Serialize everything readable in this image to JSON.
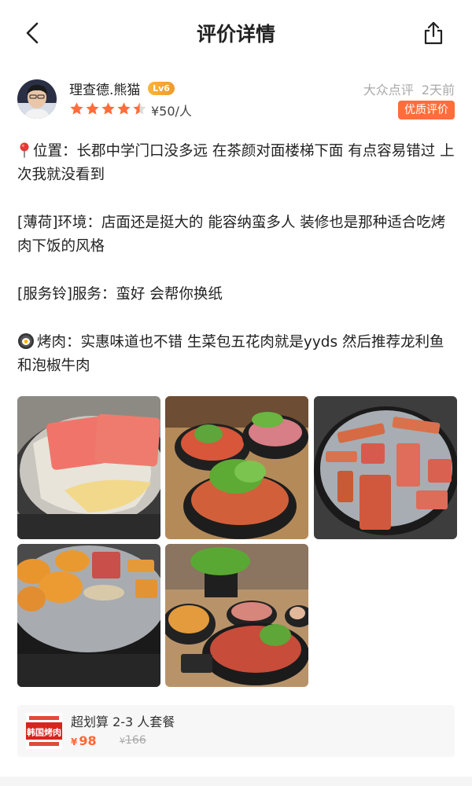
{
  "nav": {
    "title": "评价详情"
  },
  "user": {
    "name": "理查德.熊猫",
    "level": "Lv6",
    "rating": 4.5,
    "price": "¥50/人"
  },
  "meta": {
    "source": "大众点评",
    "time": "2天前",
    "badge": "优质评价"
  },
  "review": {
    "para1": "位置：长郡中学门口没多远 在茶颜对面楼梯下面 有点容易错过 上次我就没看到",
    "para2": "[薄荷]环境：店面还是挺大的 能容纳蛮多人 装修也是那种适合吃烤肉下饭的风格",
    "para3": "[服务铃]服务：蛮好 会帮你换纸",
    "para4": "烤肉：实惠味道也不错 生菜包五花肉就是yyds 然后推荐龙利鱼和泡椒牛肉"
  },
  "photos_count": 5,
  "deal": {
    "title": "超划算 2-3 人套餐",
    "currency": "¥",
    "price": "98",
    "original_currency": "¥",
    "original_price": "166",
    "thumb_text": "韩国烤肉"
  },
  "colors": {
    "accent": "#ff6633",
    "star": "#ff6d3b",
    "level_badge": "#f5a733"
  }
}
